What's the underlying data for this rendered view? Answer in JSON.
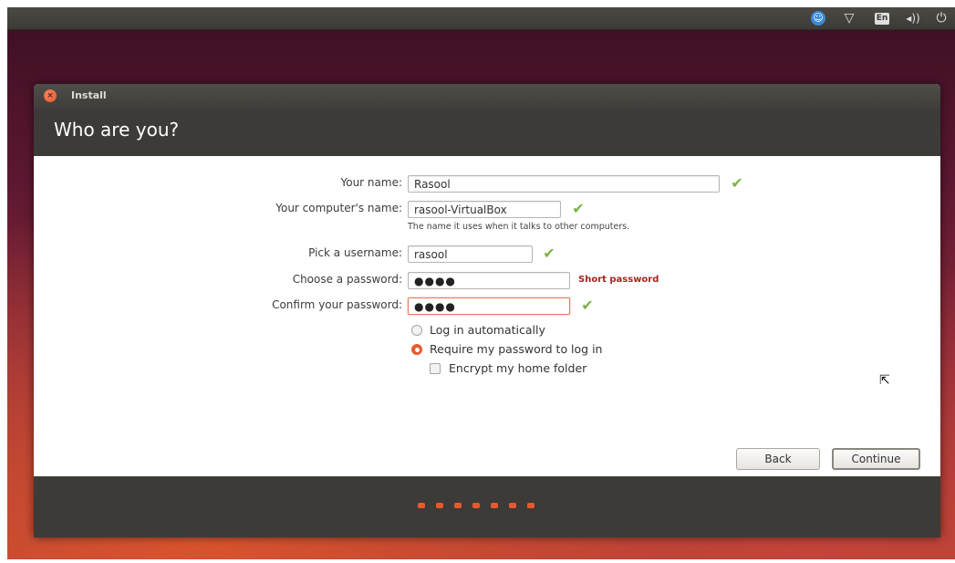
{
  "panel": {
    "accessibility_icon": "accessibility-icon",
    "network_icon": "network-icon",
    "keyboard_layout": "En",
    "sound_icon": "sound-icon",
    "settings_icon": "settings-icon"
  },
  "window": {
    "title": "Install",
    "page_title": "Who are you?"
  },
  "form": {
    "name_label": "Your name:",
    "name_value": "Rasool",
    "computer_label": "Your computer's name:",
    "computer_value": "rasool-VirtualBox",
    "computer_hint": "The name it uses when it talks to other computers.",
    "username_label": "Pick a username:",
    "username_value": "rasool",
    "password_label": "Choose a password:",
    "password_value": "●●●●",
    "password_warning": "Short password",
    "confirm_label": "Confirm your password:",
    "confirm_value": "●●●●",
    "login_auto_label": "Log in automatically",
    "login_auto_selected": false,
    "require_password_label": "Require my password to log in",
    "require_password_selected": true,
    "encrypt_label": "Encrypt my home folder",
    "encrypt_checked": false
  },
  "buttons": {
    "back": "Back",
    "continue": "Continue"
  },
  "progress": {
    "total_steps": 7
  },
  "colors": {
    "accent": "#e9582d",
    "valid_check": "#7cb342",
    "warning": "#a2261d"
  }
}
